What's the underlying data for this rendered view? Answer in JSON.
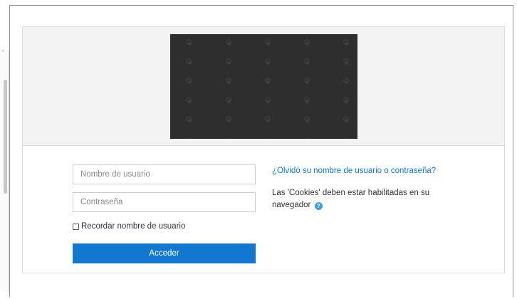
{
  "login": {
    "username_placeholder": "Nombre de usuario",
    "password_placeholder": "Contraseña",
    "remember_label": "Recordar nombre de usuario",
    "submit_label": "Acceder",
    "forgot_link": "¿Olvidó su nombre de usuario o contraseña?",
    "cookies_notice": "Las 'Cookies' deben estar habilitadas en su navegador",
    "remember_checked": false
  },
  "icons": {
    "help": "question-circle-icon",
    "logo_pattern": "power-icon"
  },
  "colors": {
    "accent": "#1177d1",
    "help_icon": "#3aa0dc",
    "logo_background": "#2e2e2e",
    "header_background": "#f3f3f3"
  }
}
